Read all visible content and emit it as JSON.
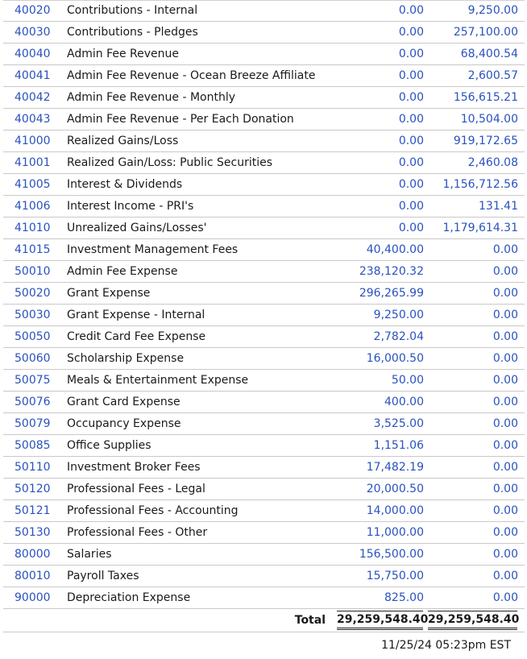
{
  "rows": [
    {
      "account": "40020",
      "name": "Contributions - Internal",
      "debit": "0.00",
      "credit": "9,250.00"
    },
    {
      "account": "40030",
      "name": "Contributions - Pledges",
      "debit": "0.00",
      "credit": "257,100.00"
    },
    {
      "account": "40040",
      "name": "Admin Fee Revenue",
      "debit": "0.00",
      "credit": "68,400.54"
    },
    {
      "account": "40041",
      "name": "Admin Fee Revenue - Ocean Breeze Affiliate",
      "debit": "0.00",
      "credit": "2,600.57"
    },
    {
      "account": "40042",
      "name": "Admin Fee Revenue - Monthly",
      "debit": "0.00",
      "credit": "156,615.21"
    },
    {
      "account": "40043",
      "name": "Admin Fee Revenue - Per Each Donation",
      "debit": "0.00",
      "credit": "10,504.00"
    },
    {
      "account": "41000",
      "name": "Realized Gains/Loss",
      "debit": "0.00",
      "credit": "919,172.65"
    },
    {
      "account": "41001",
      "name": "Realized Gain/Loss: Public Securities",
      "debit": "0.00",
      "credit": "2,460.08"
    },
    {
      "account": "41005",
      "name": "Interest & Dividends",
      "debit": "0.00",
      "credit": "1,156,712.56"
    },
    {
      "account": "41006",
      "name": "Interest Income - PRI's",
      "debit": "0.00",
      "credit": "131.41"
    },
    {
      "account": "41010",
      "name": "Unrealized Gains/Losses'",
      "debit": "0.00",
      "credit": "1,179,614.31"
    },
    {
      "account": "41015",
      "name": "Investment Management Fees",
      "debit": "40,400.00",
      "credit": "0.00"
    },
    {
      "account": "50010",
      "name": "Admin Fee Expense",
      "debit": "238,120.32",
      "credit": "0.00"
    },
    {
      "account": "50020",
      "name": "Grant Expense",
      "debit": "296,265.99",
      "credit": "0.00"
    },
    {
      "account": "50030",
      "name": "Grant Expense - Internal",
      "debit": "9,250.00",
      "credit": "0.00"
    },
    {
      "account": "50050",
      "name": "Credit Card Fee Expense",
      "debit": "2,782.04",
      "credit": "0.00"
    },
    {
      "account": "50060",
      "name": "Scholarship Expense",
      "debit": "16,000.50",
      "credit": "0.00"
    },
    {
      "account": "50075",
      "name": "Meals & Entertainment Expense",
      "debit": "50.00",
      "credit": "0.00"
    },
    {
      "account": "50076",
      "name": "Grant Card Expense",
      "debit": "400.00",
      "credit": "0.00"
    },
    {
      "account": "50079",
      "name": "Occupancy Expense",
      "debit": "3,525.00",
      "credit": "0.00"
    },
    {
      "account": "50085",
      "name": "Office Supplies",
      "debit": "1,151.06",
      "credit": "0.00"
    },
    {
      "account": "50110",
      "name": "Investment Broker Fees",
      "debit": "17,482.19",
      "credit": "0.00"
    },
    {
      "account": "50120",
      "name": "Professional Fees - Legal",
      "debit": "20,000.50",
      "credit": "0.00"
    },
    {
      "account": "50121",
      "name": "Professional Fees - Accounting",
      "debit": "14,000.00",
      "credit": "0.00"
    },
    {
      "account": "50130",
      "name": "Professional Fees - Other",
      "debit": "11,000.00",
      "credit": "0.00"
    },
    {
      "account": "80000",
      "name": "Salaries",
      "debit": "156,500.00",
      "credit": "0.00"
    },
    {
      "account": "80010",
      "name": "Payroll Taxes",
      "debit": "15,750.00",
      "credit": "0.00"
    },
    {
      "account": "90000",
      "name": "Depreciation Expense",
      "debit": "825.00",
      "credit": "0.00"
    }
  ],
  "total": {
    "label": "Total",
    "debit": "29,259,548.40",
    "credit": "29,259,548.40"
  },
  "timestamp": "11/25/24 05:23pm EST",
  "colors": {
    "link": "#2a52be",
    "text": "#1a1a1a",
    "rule": "#c9c9c9"
  }
}
